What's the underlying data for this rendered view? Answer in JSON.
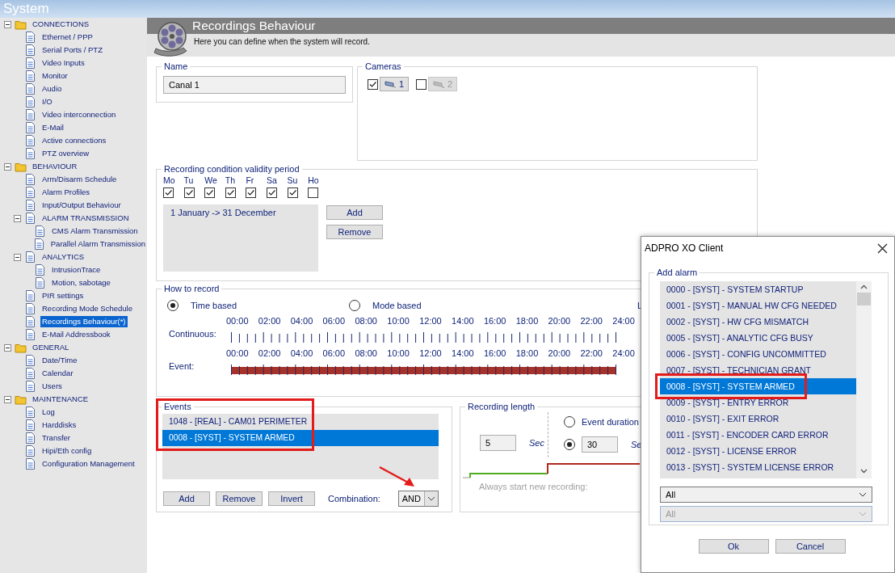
{
  "window": {
    "title": "System"
  },
  "sidebar": {
    "items": [
      {
        "label": "CONNECTIONS",
        "expanded": true,
        "selected": false,
        "children": [
          {
            "label": "Ethernet / PPP",
            "selected": false
          },
          {
            "label": "Serial Ports / PTZ",
            "selected": false
          },
          {
            "label": "Video Inputs",
            "selected": false
          },
          {
            "label": "Monitor",
            "selected": false
          },
          {
            "label": "Audio",
            "selected": false
          },
          {
            "label": "I/O",
            "selected": false
          },
          {
            "label": "Video interconnection",
            "selected": false
          },
          {
            "label": "E-Mail",
            "selected": false
          },
          {
            "label": "Active connections",
            "selected": false
          },
          {
            "label": "PTZ overview",
            "selected": false
          }
        ]
      },
      {
        "label": "BEHAVIOUR",
        "expanded": true,
        "selected": false,
        "children": [
          {
            "label": "Arm/Disarm Schedule",
            "selected": false
          },
          {
            "label": "Alarm Profiles",
            "selected": false
          },
          {
            "label": "Input/Output Behaviour",
            "selected": false
          },
          {
            "label": "ALARM TRANSMISSION",
            "expanded": true,
            "selected": false,
            "children": [
              {
                "label": "CMS Alarm Transmission",
                "selected": false
              },
              {
                "label": "Parallel Alarm Transmission",
                "selected": false
              }
            ]
          },
          {
            "label": "ANALYTICS",
            "expanded": true,
            "selected": false,
            "children": [
              {
                "label": "IntrusionTrace",
                "selected": false
              },
              {
                "label": "Motion, sabotage",
                "selected": false
              }
            ]
          },
          {
            "label": "PIR settings",
            "selected": false
          },
          {
            "label": "Recording Mode Schedule",
            "selected": false
          },
          {
            "label": "Recordings Behaviour(*)",
            "selected": true
          },
          {
            "label": "E-Mail Addressbook",
            "selected": false
          }
        ]
      },
      {
        "label": "GENERAL",
        "expanded": true,
        "selected": false,
        "children": [
          {
            "label": "Date/Time",
            "selected": false
          },
          {
            "label": "Calendar",
            "selected": false
          },
          {
            "label": "Users",
            "selected": false
          }
        ]
      },
      {
        "label": "MAINTENANCE",
        "expanded": true,
        "selected": false,
        "children": [
          {
            "label": "Log",
            "selected": false
          },
          {
            "label": "Harddisks",
            "selected": false
          },
          {
            "label": "Transfer",
            "selected": false
          },
          {
            "label": "Hipi/Eth config",
            "selected": false
          },
          {
            "label": "Configuration Management",
            "selected": false
          }
        ]
      }
    ]
  },
  "header": {
    "title": "Recordings Behaviour",
    "subtitle": "Here you can define when the system will record."
  },
  "name_panel": {
    "legend": "Name",
    "value": "Canal 1"
  },
  "cameras_panel": {
    "legend": "Cameras",
    "cameras": [
      {
        "label": "1",
        "checked": true,
        "disabled": false
      },
      {
        "label": "2",
        "checked": false,
        "disabled": true
      }
    ]
  },
  "validity_panel": {
    "legend": "Recording condition validity period",
    "days": [
      {
        "label": "Mo",
        "checked": true
      },
      {
        "label": "Tu",
        "checked": true
      },
      {
        "label": "We",
        "checked": true
      },
      {
        "label": "Th",
        "checked": true
      },
      {
        "label": "Fr",
        "checked": true
      },
      {
        "label": "Sa",
        "checked": true
      },
      {
        "label": "Su",
        "checked": true
      },
      {
        "label": "Ho",
        "checked": false
      }
    ],
    "periods": [
      {
        "label": "1 January -> 31 December",
        "selected": false
      }
    ],
    "buttons": [
      "Add",
      "Remove"
    ]
  },
  "how_to_record": {
    "legend": "How to record",
    "modes": [
      {
        "label": "Time based",
        "selected": true
      },
      {
        "label": "Mode based",
        "selected": false
      }
    ],
    "cut_label": "L",
    "rulers": [
      {
        "label": "Continuous:",
        "filled": false,
        "ticks": [
          "00:00",
          "02:00",
          "04:00",
          "06:00",
          "08:00",
          "10:00",
          "12:00",
          "14:00",
          "16:00",
          "18:00",
          "20:00",
          "22:00",
          "24:00"
        ]
      },
      {
        "label": "Event:",
        "filled": true,
        "ticks": [
          "00:00",
          "02:00",
          "04:00",
          "06:00",
          "08:00",
          "10:00",
          "12:00",
          "14:00",
          "16:00",
          "18:00",
          "20:00",
          "22:00",
          "24:00"
        ]
      }
    ]
  },
  "events_panel": {
    "legend": "Events",
    "items": [
      {
        "label": "1048 - [REAL] - CAM01 PERIMETER",
        "selected": false
      },
      {
        "label": "0008 - [SYST] - SYSTEM ARMED",
        "selected": true
      }
    ],
    "buttons": [
      "Add",
      "Remove",
      "Invert"
    ],
    "combination_label": "Combination:",
    "combination_value": "AND"
  },
  "recording_length": {
    "legend": "Recording length",
    "pre_value": "5",
    "pre_unit": "Sec",
    "modes": [
      {
        "kind": "label",
        "label": "Event duration",
        "selected": false
      },
      {
        "kind": "field",
        "value": "30",
        "unit": "Se",
        "selected": true
      }
    ],
    "note": "Always start new recording:",
    "note_disabled": true
  },
  "dialog": {
    "title": "ADPRO XO Client",
    "legend": "Add alarm",
    "alarms": [
      {
        "label": "0000 - [SYST] - SYSTEM STARTUP",
        "selected": false
      },
      {
        "label": "0001 - [SYST] - MANUAL HW CFG NEEDED",
        "selected": false
      },
      {
        "label": "0002 - [SYST] - HW CFG MISMATCH",
        "selected": false
      },
      {
        "label": "0005 - [SYST] - ANALYTIC CFG BUSY",
        "selected": false
      },
      {
        "label": "0006 - [SYST] - CONFIG UNCOMMITTED",
        "selected": false
      },
      {
        "label": "0007 - [SYST] - TECHNICIAN GRANT",
        "selected": false
      },
      {
        "label": "0008 - [SYST] - SYSTEM ARMED",
        "selected": true
      },
      {
        "label": "0009 - [SYST] - ENTRY ERROR",
        "selected": false
      },
      {
        "label": "0010 - [SYST] - EXIT ERROR",
        "selected": false
      },
      {
        "label": "0011 - [SYST] - ENCODER CARD ERROR",
        "selected": false
      },
      {
        "label": "0012 - [SYST] - LICENSE ERROR",
        "selected": false
      },
      {
        "label": "0013 - [SYST] - SYSTEM LICENSE ERROR",
        "selected": false
      }
    ],
    "filters": [
      {
        "value": "All",
        "disabled": false
      },
      {
        "value": "All",
        "disabled": true
      }
    ],
    "buttons": [
      "Ok",
      "Cancel"
    ]
  },
  "annotations": {
    "events_frame": true,
    "alarm_frame": true,
    "arrow": true
  }
}
